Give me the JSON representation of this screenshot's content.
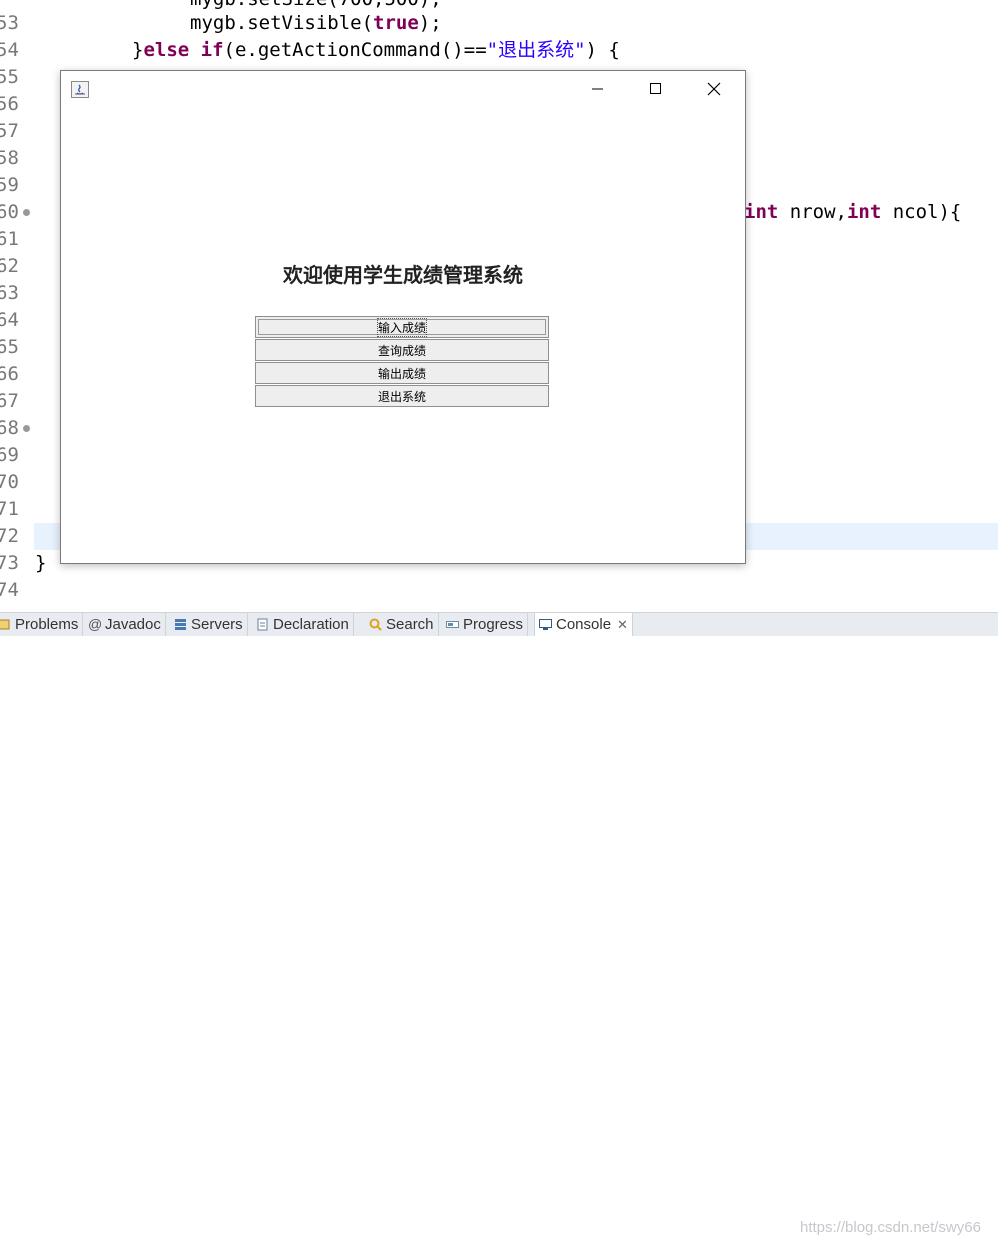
{
  "editor": {
    "line_numbers": [
      "53",
      "54",
      "55",
      "56",
      "57",
      "58",
      "59",
      "60",
      "61",
      "62",
      "63",
      "64",
      "65",
      "66",
      "67",
      "68",
      "69",
      "70",
      "71",
      "72",
      "73",
      "74"
    ],
    "lines": {
      "l53_code": "mygb.setSize(700,500);",
      "l53b_obj": "mygb.setVisible(",
      "l53b_kw": "true",
      "l53b_end": ");",
      "l54_a": "}",
      "l54_kw1": "else if",
      "l54_b": "(e.getActionCommand()==",
      "l54_str": "\"退出系统\"",
      "l54_c": ") {",
      "l60_kw1": "int",
      "l60_a": " nrow,",
      "l60_kw2": "int",
      "l60_b": " ncol){",
      "l73": "}"
    }
  },
  "bottom_tabs": [
    {
      "label": "Problems",
      "icon": "problems-icon"
    },
    {
      "label": "Javadoc",
      "icon": "at-icon"
    },
    {
      "label": "Servers",
      "icon": "servers-icon"
    },
    {
      "label": "Declaration",
      "icon": "declaration-icon"
    },
    {
      "label": "Search",
      "icon": "search-icon"
    },
    {
      "label": "Progress",
      "icon": "progress-icon"
    },
    {
      "label": "Console",
      "icon": "console-icon",
      "active": true
    }
  ],
  "watermark": "https://blog.csdn.net/swy66",
  "window": {
    "heading": "欢迎使用学生成绩管理系统",
    "buttons": [
      "输入成绩",
      "查询成绩",
      "输出成绩",
      "退出系统"
    ]
  }
}
